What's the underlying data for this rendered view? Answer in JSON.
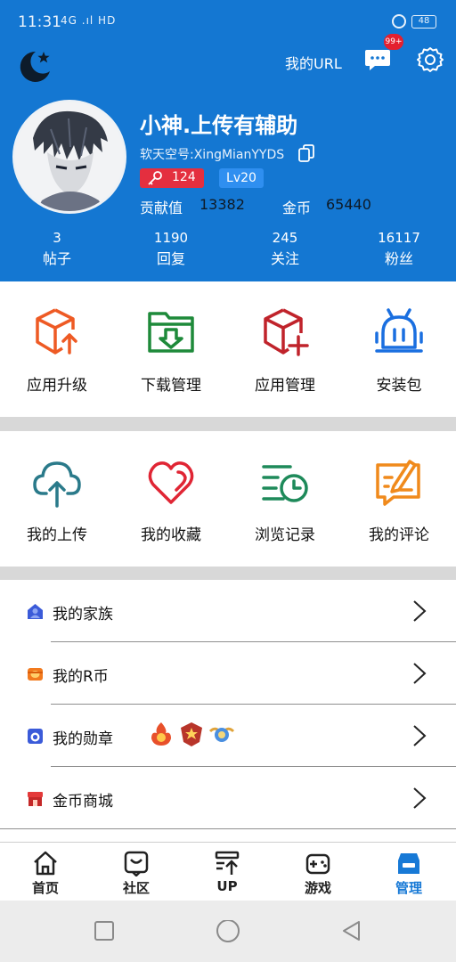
{
  "status_bar": {
    "time": "11:31",
    "signal": "4G .ıl  HD",
    "battery": "48"
  },
  "header": {
    "url_label": "我的URL",
    "message_badge": "99+",
    "colors": {
      "header_bg": "#1477d2",
      "accent_blue": "#1779d6",
      "badge_red": "#e42f3f"
    }
  },
  "profile": {
    "name": "小神.上传有辅助",
    "id_text": "软天空号:XingMianYYDS",
    "key_count": "124",
    "level": "Lv20",
    "contribution_label": "贡献值",
    "contribution_value": "13382",
    "coin_label": "金币",
    "coin_value": "65440"
  },
  "stats": [
    {
      "value": "3",
      "label": "帖子"
    },
    {
      "value": "1190",
      "label": "回复"
    },
    {
      "value": "245",
      "label": "关注"
    },
    {
      "value": "16117",
      "label": "粉丝"
    }
  ],
  "grid1": [
    {
      "label": "应用升级",
      "icon": "box-upgrade-icon"
    },
    {
      "label": "下载管理",
      "icon": "download-folder-icon"
    },
    {
      "label": "应用管理",
      "icon": "box-add-icon"
    },
    {
      "label": "安装包",
      "icon": "android-icon"
    }
  ],
  "grid2": [
    {
      "label": "我的上传",
      "icon": "cloud-upload-icon"
    },
    {
      "label": "我的收藏",
      "icon": "heart-icon"
    },
    {
      "label": "浏览记录",
      "icon": "history-icon"
    },
    {
      "label": "我的评论",
      "icon": "comment-edit-icon"
    }
  ],
  "list": [
    {
      "label": "我的家族",
      "icon": "family-icon"
    },
    {
      "label": "我的R币",
      "icon": "rcoin-icon"
    },
    {
      "label": "我的勋章",
      "icon": "medal-icon"
    },
    {
      "label": "金币商城",
      "icon": "shop-icon"
    }
  ],
  "bottom_nav": [
    {
      "label": "首页",
      "icon": "home-icon"
    },
    {
      "label": "社区",
      "icon": "community-icon"
    },
    {
      "label": "UP",
      "icon": "upload-icon"
    },
    {
      "label": "游戏",
      "icon": "gamepad-icon"
    },
    {
      "label": "管理",
      "icon": "manage-icon",
      "active": true
    }
  ]
}
